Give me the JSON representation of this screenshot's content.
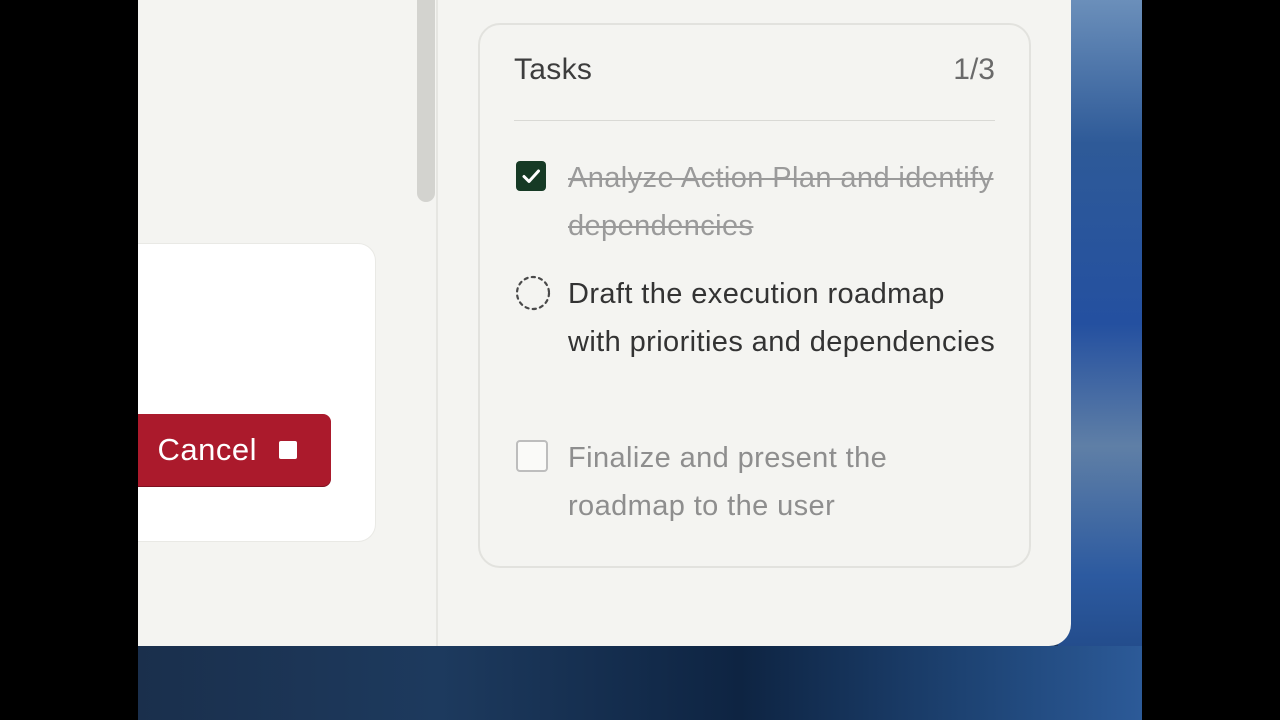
{
  "left_pane": {
    "cancel_button": {
      "label": "Cancel",
      "icon": "stop-icon"
    }
  },
  "tasks": {
    "title": "Tasks",
    "count": "1/3",
    "items": [
      {
        "text": "Analyze Action Plan and identify dependencies",
        "status": "completed",
        "icon": "checkbox-checked-icon"
      },
      {
        "text": "Draft the execution roadmap with priorities and dependencies",
        "status": "in-progress",
        "icon": "spinner-icon"
      },
      {
        "text": "Finalize and present the roadmap to the user",
        "status": "pending",
        "icon": "checkbox-empty-icon"
      }
    ]
  },
  "colors": {
    "cancel_bg": "#ab1a2c",
    "check_done_bg": "#163a25",
    "panel_bg": "#f4f4f1"
  }
}
